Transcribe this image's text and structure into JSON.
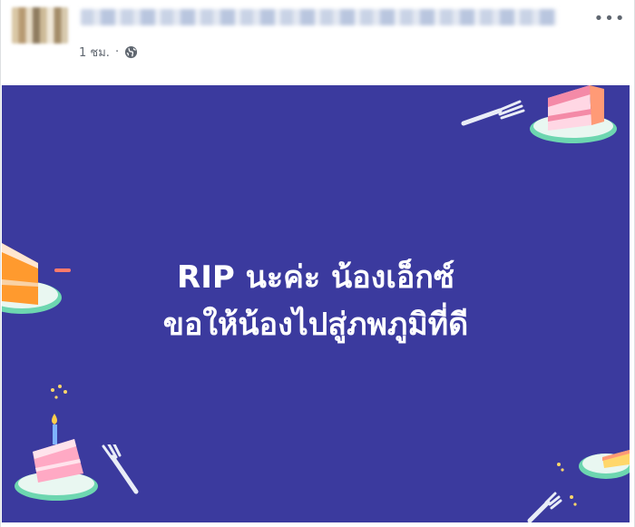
{
  "post": {
    "timestamp": "1 ชม.",
    "separator": "·",
    "privacy_icon": "globe-icon",
    "more_label": "•••"
  },
  "banner": {
    "background_color": "#3b3a9e",
    "line1": "RIP นะค่ะ น้องเอ็กซ์",
    "line2": "ขอให้น้องไปสู่ภพภูมิที่ดี"
  }
}
